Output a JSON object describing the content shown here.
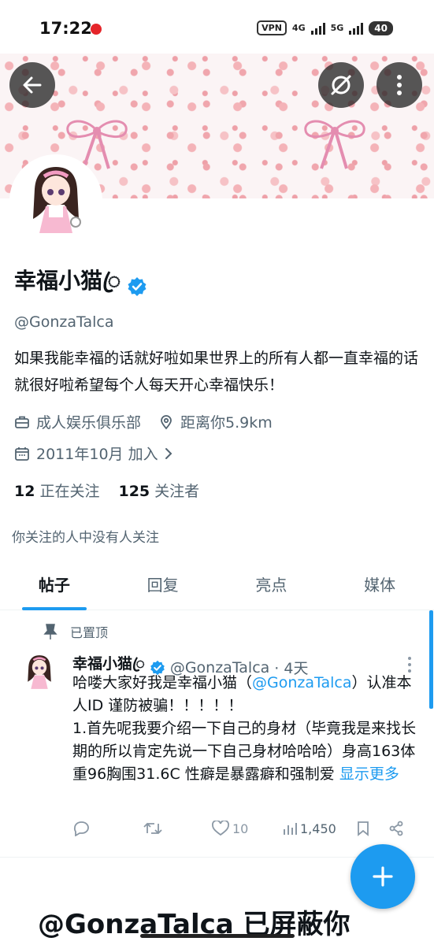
{
  "status_bar": {
    "time": "17:22",
    "vpn": "VPN",
    "net1": "4G",
    "net2": "5G",
    "battery": "40"
  },
  "profile": {
    "display_name": "幸福小猫ꦿ",
    "handle": "@GonzaTalca",
    "bio": "如果我能幸福的话就好啦如果世界上的所有人都一直幸福的话就很好啦希望每个人每天开心幸福快乐！",
    "category": "成人娱乐俱乐部",
    "location": "距离你5.9km",
    "joined": "2011年10月 加入",
    "following_count": "12",
    "following_label": "正在关注",
    "followers_count": "125",
    "followers_label": "关注者",
    "mutual_note": "你关注的人中没有人关注"
  },
  "tabs": [
    {
      "label": "帖子",
      "active": true
    },
    {
      "label": "回复",
      "active": false
    },
    {
      "label": "亮点",
      "active": false
    },
    {
      "label": "媒体",
      "active": false
    }
  ],
  "pinned_tweet": {
    "pinned_label": "已置顶",
    "name": "幸福小猫ꦿ",
    "handle": "@GonzaTalca",
    "time": "· 4天",
    "text_1": "哈喽大家好我是幸福小猫（",
    "mention": "@GonzaTalca",
    "text_2": "）认准本人ID 谨防被骗！！！！！",
    "text_3": "1.首先呢我要介绍一下自己的身材（毕竟我是来找长期的所以肯定先说一下自己身材哈哈哈）身高163体重96胸围31.6C 性癖是暴露癖和强制爱",
    "show_more": "显示更多",
    "likes": "10",
    "views": "1,450"
  },
  "blocked_notice": "@GonzaTalca 已屏蔽你",
  "colors": {
    "accent": "#1d9bf0",
    "secondary_text": "#536471"
  }
}
